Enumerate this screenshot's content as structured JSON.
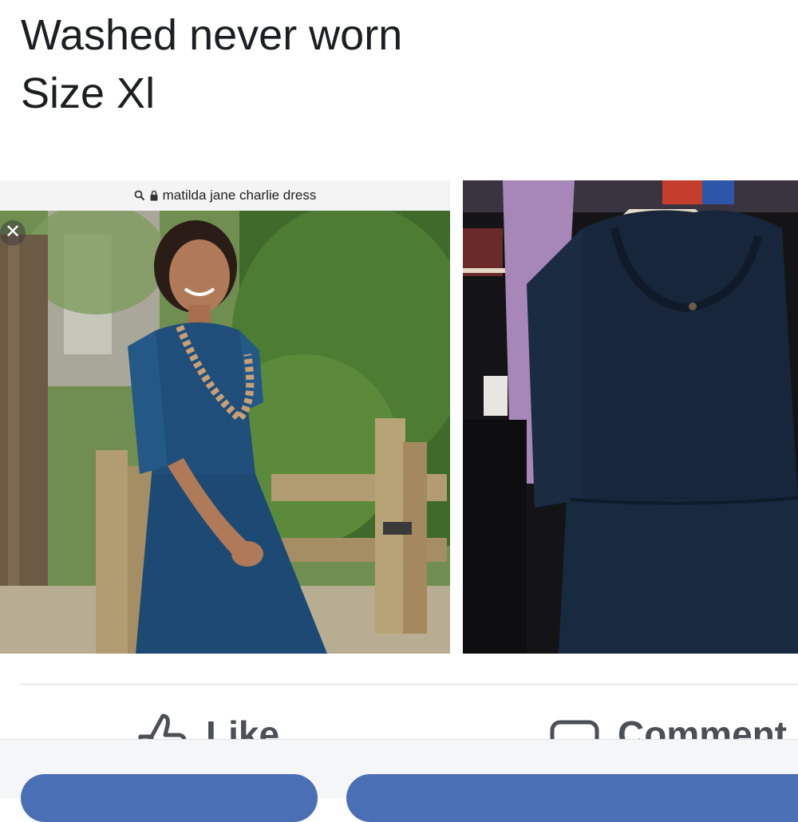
{
  "post": {
    "line1": "Washed never worn",
    "line2": "Size Xl"
  },
  "left_photo": {
    "url_text": "matilda jane charlie dress",
    "close_symbol": "✕"
  },
  "actions": {
    "like_label": "Like",
    "comment_label": "Comment"
  },
  "colors": {
    "text": "#1c1e21",
    "action_gray": "#4b4f56",
    "pill_blue": "#4a6fb5",
    "dress_blue": "#1f4e7a",
    "dress_navy": "#17263a"
  },
  "icons": {
    "like": "thumbs-up-icon",
    "comment": "comment-bubble-icon",
    "search": "search-icon",
    "lock": "lock-icon",
    "close": "close-icon"
  }
}
